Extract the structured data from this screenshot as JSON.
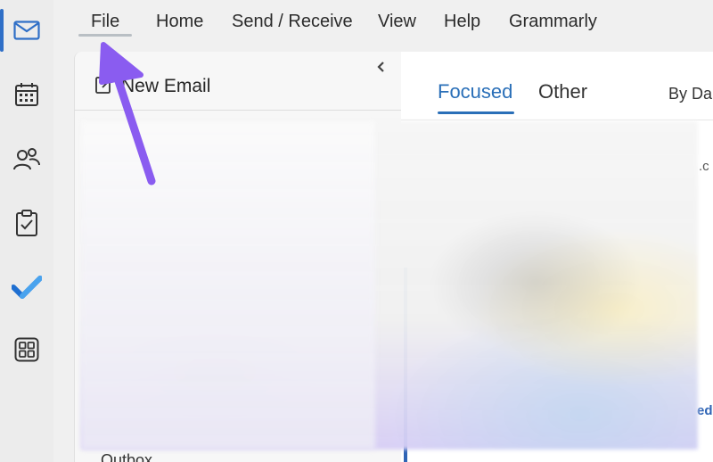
{
  "rail": {
    "items": [
      {
        "name": "mail",
        "icon": "mail-icon",
        "active": true
      },
      {
        "name": "calendar",
        "icon": "calendar-icon"
      },
      {
        "name": "people",
        "icon": "people-icon"
      },
      {
        "name": "tasks",
        "icon": "clipboard-check-icon"
      },
      {
        "name": "todo",
        "icon": "todo-check-icon"
      },
      {
        "name": "apps",
        "icon": "apps-grid-icon"
      }
    ],
    "accent_color": "#2f6fc7"
  },
  "menubar": {
    "items": [
      "File",
      "Home",
      "Send / Receive",
      "View",
      "Help",
      "Grammarly"
    ]
  },
  "folder_pane": {
    "new_email_label": "New Email",
    "collapse_icon": "chevron-left-icon",
    "outbox_label": "Outbox"
  },
  "list_pane": {
    "tabs": [
      {
        "label": "Focused",
        "active": true
      },
      {
        "label": "Other",
        "active": false
      }
    ],
    "sort_label": "By Da",
    "edge_text_1": ".c",
    "edge_text_2": "ed",
    "accent_color": "#2a6fb8"
  },
  "annotation": {
    "arrow_color": "#8a5cf0",
    "icon": "pointer-arrow"
  }
}
